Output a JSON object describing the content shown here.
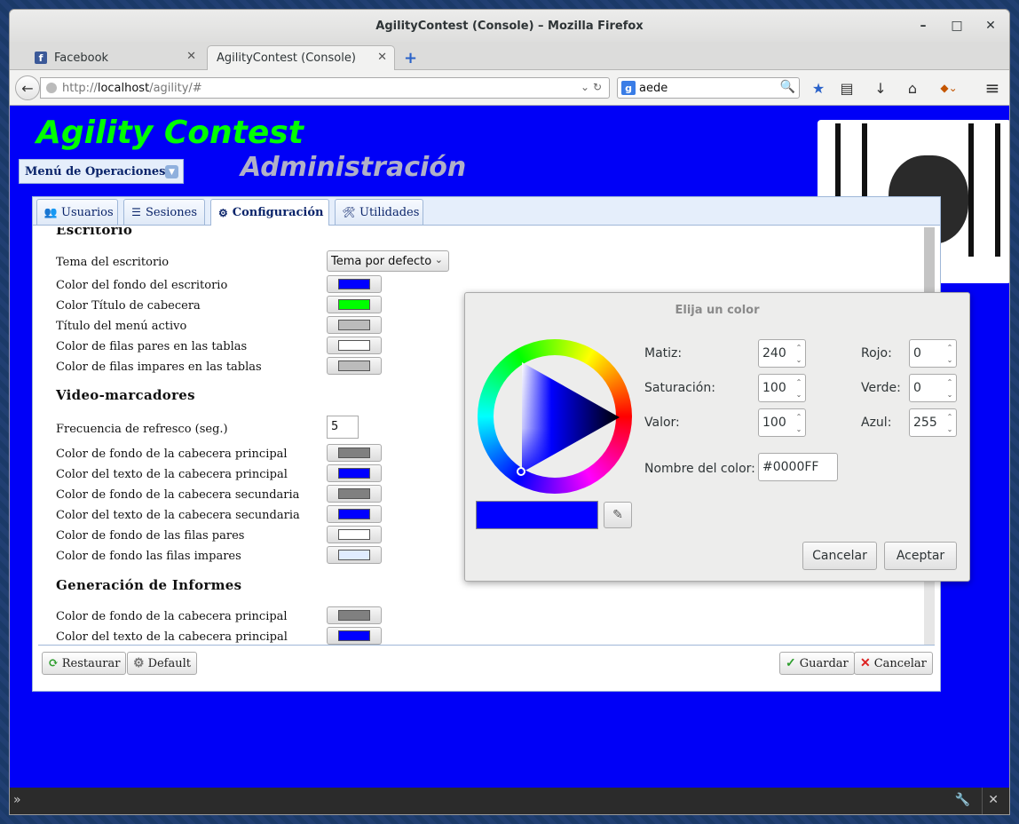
{
  "window": {
    "title": "AgilityContest (Console) – Mozilla Firefox",
    "minimize": "–",
    "maximize": "□",
    "close": "✕"
  },
  "tabs": [
    {
      "label": "Facebook",
      "close": "✕"
    },
    {
      "label": "AgilityContest (Console)",
      "close": "✕"
    }
  ],
  "newtab": "+",
  "nav": {
    "back": "←",
    "url_prefix": "http://",
    "url_host": "localhost",
    "url_path": "/agility/#",
    "url_dropdown": "⌄",
    "reload": "↻",
    "search_engine": "g",
    "search_value": "aede",
    "search_button": "🔍",
    "bookmark": "★",
    "library": "▤",
    "download": "↓",
    "home": "⌂",
    "addon": "◆⌄",
    "menu": "≡"
  },
  "app": {
    "title": "Agility Contest",
    "subtitle": "Administración",
    "operations_menu": "Menú de Operaciones",
    "operations_menu_icon": "▼"
  },
  "panel_tabs": [
    {
      "label": "Usuarios",
      "icon": "👥"
    },
    {
      "label": "Sesiones",
      "icon": "☰"
    },
    {
      "label": "Configuración",
      "icon": "⚙"
    },
    {
      "label": "Utilidades",
      "icon": "🛠"
    }
  ],
  "form": {
    "section_escritorio": "Escritorio",
    "theme_label": "Tema del escritorio",
    "theme_value": "Tema por defecto",
    "theme_arrow": "⌄",
    "escritorio_rows": [
      {
        "label": "Color del fondo del escritorio",
        "color": "#0000ff"
      },
      {
        "label": "Color Título de cabecera",
        "color": "#00ff00"
      },
      {
        "label": "Título del menú activo",
        "color": "#bbbbbb"
      },
      {
        "label": "Color de filas pares en las tablas",
        "color": "#ffffff"
      },
      {
        "label": "Color de filas impares en las tablas",
        "color": "#bbbbbb"
      }
    ],
    "section_video": "Video-marcadores",
    "refresh_label": "Frecuencia de refresco (seg.)",
    "refresh_value": "5",
    "video_rows": [
      {
        "label": "Color de fondo de la cabecera principal",
        "color": "#808080"
      },
      {
        "label": "Color del texto de la cabecera principal",
        "color": "#0000ff"
      },
      {
        "label": "Color de fondo de la cabecera secundaria",
        "color": "#808080"
      },
      {
        "label": "Color del texto de la cabecera secundaria",
        "color": "#0000ff"
      },
      {
        "label": "Color de fondo de las filas pares",
        "color": "#ffffff"
      },
      {
        "label": "Color de fondo las filas impares",
        "color": "#e0ecff"
      }
    ],
    "section_informes": "Generación de Informes",
    "informes_rows": [
      {
        "label": "Color de fondo de la cabecera principal",
        "color": "#808080"
      },
      {
        "label": "Color del texto de la cabecera principal",
        "color": "#0000ff"
      }
    ]
  },
  "buttons": {
    "restore": "Restaurar",
    "restore_icon": "⟳",
    "default": "Default",
    "default_icon": "⚙",
    "save": "Guardar",
    "save_icon": "✓",
    "cancel": "Cancelar",
    "cancel_icon": "✕"
  },
  "color_dialog": {
    "title": "Elija un color",
    "hue_label": "Matiz:",
    "hue": "240",
    "saturation_label": "Saturación:",
    "saturation": "100",
    "value_label": "Valor:",
    "value": "100",
    "red_label": "Rojo:",
    "red": "0",
    "green_label": "Verde:",
    "green": "0",
    "blue_label": "Azul:",
    "blue": "255",
    "name_label": "Nombre del color:",
    "name_value": "#0000FF",
    "eyedropper": "✎",
    "spin_up": "⌃",
    "spin_down": "⌄",
    "cancel": "Cancelar",
    "accept": "Aceptar",
    "current_color": "#0000ff"
  },
  "devtools": {
    "chevron": "»",
    "wrench": "🔧",
    "close": "✕"
  },
  "colors": {
    "desktop": "#0000f7",
    "title_green": "#00ff00",
    "subtitle_gray": "#b0b0c8"
  }
}
